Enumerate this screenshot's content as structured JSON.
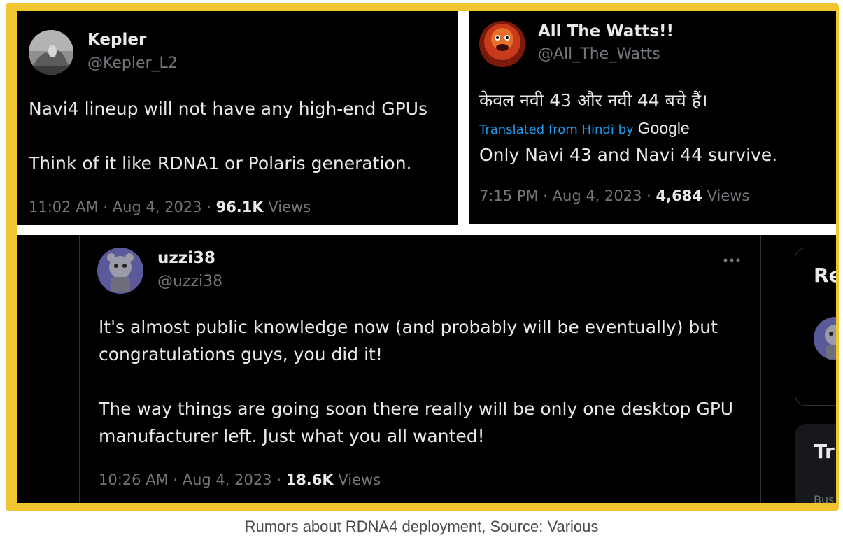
{
  "tweets": [
    {
      "name": "Kepler",
      "handle": "@Kepler_L2",
      "text": "Navi4 lineup will not have any high-end GPUs\n\nThink of it like RDNA1 or Polaris generation.",
      "time": "11:02 AM · Aug 4, 2023 · ",
      "views_count": "96.1K",
      "views_label": " Views"
    },
    {
      "name": "All The Watts!!",
      "handle": "@All_The_Watts",
      "text_original": "केवल नवी 43 और नवी 44 बचे हैं।",
      "translated_label": "Translated from Hindi by",
      "translator": "Google",
      "text": "Only Navi 43 and Navi 44 survive.",
      "time": "7:15 PM · Aug 4, 2023 · ",
      "views_count": "4,684",
      "views_label": " Views"
    },
    {
      "name": "uzzi38",
      "handle": "@uzzi38",
      "text": "It's almost public knowledge now (and probably will be eventually) but congratulations guys, you did it!\n\nThe way things are going soon there really will be only one desktop GPU manufacturer left. Just what you all wanted!",
      "time": "10:26 AM · Aug 4, 2023 · ",
      "views_count": "18.6K",
      "views_label": " Views"
    }
  ],
  "sidebar": {
    "card1_title": "Re",
    "card2_title": "Tr",
    "card2_small": "Bus"
  },
  "caption": "Rumors about RDNA4 deployment, Source: Various",
  "colors": {
    "frame": "#f0c530",
    "link": "#1d9bf0",
    "muted": "#71767b",
    "text": "#e7e9ea"
  }
}
